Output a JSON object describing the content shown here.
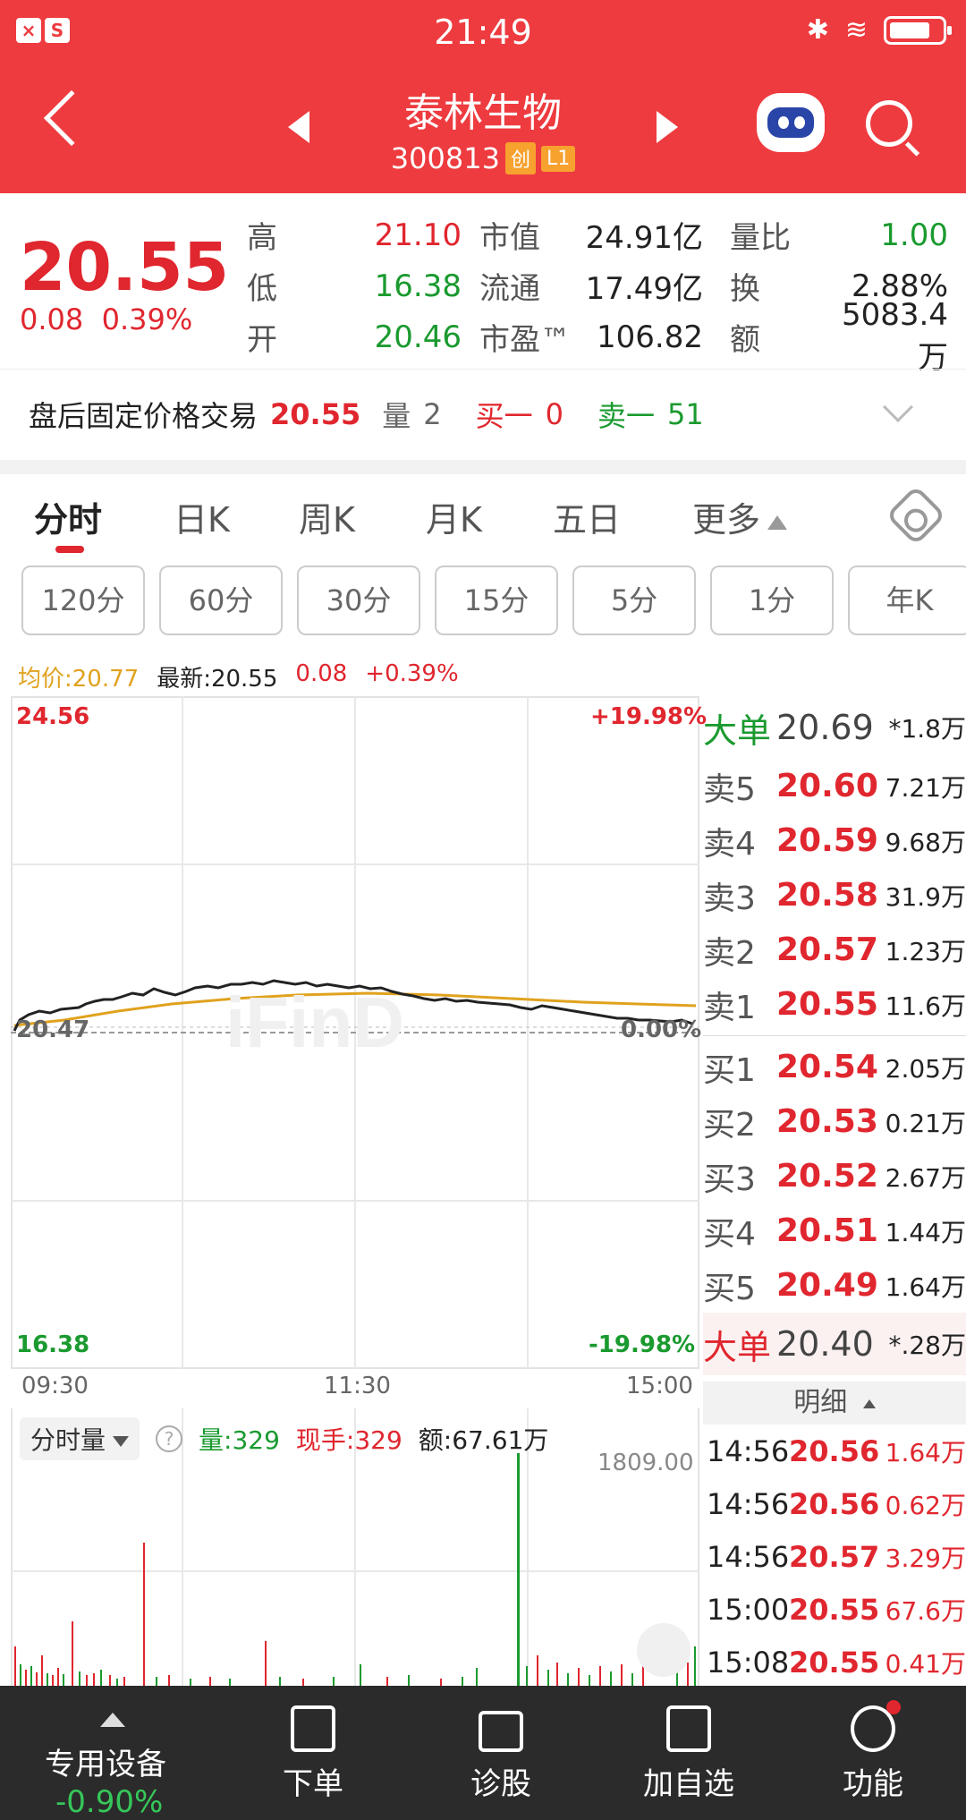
{
  "status": {
    "time": "21:49"
  },
  "header": {
    "name": "泰林生物",
    "code": "300813",
    "tag1": "创",
    "tag2": "L1"
  },
  "quote": {
    "price": "20.55",
    "change": "0.08",
    "change_pct": "0.39%",
    "rows": [
      {
        "l1": "高",
        "v1": "21.10",
        "l2": "市值",
        "v2": "24.91亿",
        "l3": "量比",
        "v3": "1.00"
      },
      {
        "l1": "低",
        "v1": "16.38",
        "l2": "流通",
        "v2": "17.49亿",
        "l3": "换",
        "v3": "2.88%"
      },
      {
        "l1": "开",
        "v1": "20.46",
        "l2": "市盈™",
        "v2": "106.82",
        "l3": "额",
        "v3": "5083.4万"
      }
    ]
  },
  "after_hours": {
    "label": "盘后固定价格交易",
    "price": "20.55",
    "vol_label": "量",
    "vol": "2",
    "buy_label": "买一",
    "buy": "0",
    "sell_label": "卖一",
    "sell": "51"
  },
  "tabs": [
    "分时",
    "日K",
    "周K",
    "月K",
    "五日",
    "更多"
  ],
  "periods": [
    "120分",
    "60分",
    "30分",
    "15分",
    "5分",
    "1分",
    "年K"
  ],
  "legend": {
    "avg": "均价:20.77",
    "latest": "最新:20.55",
    "chg": "0.08",
    "pct": "+0.39%"
  },
  "chart_labels": {
    "top_price": "24.56",
    "top_pct": "+19.98%",
    "mid_price": "20.47",
    "mid_pct": "0.00%",
    "bottom_price": "16.38",
    "bottom_pct": "-19.98%"
  },
  "time_axis": [
    "09:30",
    "11:30",
    "15:00"
  ],
  "book": {
    "big_sell": {
      "label": "大单",
      "price": "20.69",
      "vol": "*1.8万"
    },
    "asks": [
      {
        "label": "卖5",
        "price": "20.60",
        "vol": "7.21万"
      },
      {
        "label": "卖4",
        "price": "20.59",
        "vol": "9.68万"
      },
      {
        "label": "卖3",
        "price": "20.58",
        "vol": "31.9万"
      },
      {
        "label": "卖2",
        "price": "20.57",
        "vol": "1.23万"
      },
      {
        "label": "卖1",
        "price": "20.55",
        "vol": "11.6万"
      }
    ],
    "bids": [
      {
        "label": "买1",
        "price": "20.54",
        "vol": "2.05万"
      },
      {
        "label": "买2",
        "price": "20.53",
        "vol": "0.21万"
      },
      {
        "label": "买3",
        "price": "20.52",
        "vol": "2.67万"
      },
      {
        "label": "买4",
        "price": "20.51",
        "vol": "1.44万"
      },
      {
        "label": "买5",
        "price": "20.49",
        "vol": "1.64万"
      }
    ],
    "big_buy": {
      "label": "大单",
      "price": "20.40",
      "vol": "*.28万"
    }
  },
  "mingxi": {
    "label": "明细"
  },
  "trades": [
    {
      "time": "14:56",
      "price": "20.56",
      "vol": "1.64万"
    },
    {
      "time": "14:56",
      "price": "20.56",
      "vol": "0.62万"
    },
    {
      "time": "14:56",
      "price": "20.57",
      "vol": "3.29万"
    },
    {
      "time": "15:00",
      "price": "20.55",
      "vol": "67.6万"
    },
    {
      "time": "15:08",
      "price": "20.55",
      "vol": "0.41万"
    }
  ],
  "volume": {
    "selector": "分时量",
    "help": "?",
    "vol": "量:329",
    "now": "现手:329",
    "amount": "额:67.61万",
    "max": "1809.00"
  },
  "bottom_nav": {
    "market": "专用设备",
    "market_val": "-0.90%",
    "items": [
      "下单",
      "诊股",
      "加自选",
      "功能"
    ]
  },
  "colors": {
    "header_red": "#ee3b3f",
    "up_red": "#e0262e",
    "down_green": "#1a9a2f",
    "avg_line": "#e0a21e"
  }
}
